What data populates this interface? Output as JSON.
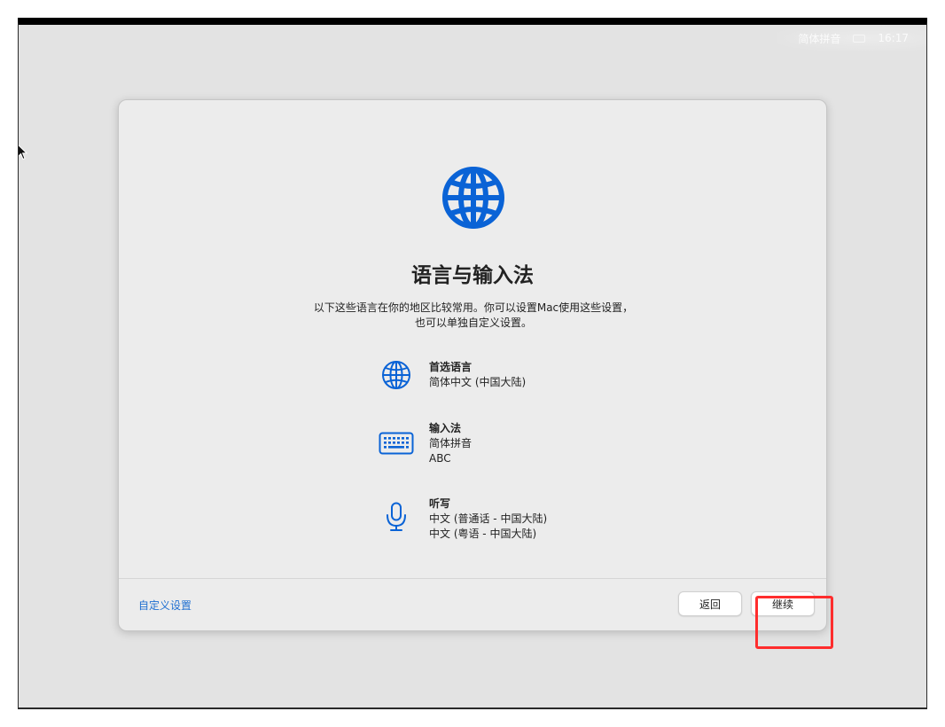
{
  "menubar": {
    "input_method": "简体拼音",
    "keyboard_icon": "keyboard-icon",
    "time": "16:17"
  },
  "dialog": {
    "icon": "globe-icon",
    "title": "语言与输入法",
    "description": [
      "以下这些语言在你的地区比较常用。你可以设置Mac使用这些设置，",
      "也可以单独自定义设置。"
    ],
    "settings": [
      {
        "icon": "globe-icon",
        "label": "首选语言",
        "values": [
          "简体中文 (中国大陆)"
        ]
      },
      {
        "icon": "keyboard-icon",
        "label": "输入法",
        "values": [
          "简体拼音",
          "ABC"
        ]
      },
      {
        "icon": "microphone-icon",
        "label": "听写",
        "values": [
          "中文 (普通话 - 中国大陆)",
          "中文 (粤语 - 中国大陆)"
        ]
      }
    ],
    "footer": {
      "customize_link": "自定义设置",
      "back_button": "返回",
      "continue_button": "继续"
    }
  },
  "colors": {
    "accent": "#1f6fd1",
    "icon_blue": "#0a63d6",
    "highlight": "#ff2d2d",
    "background": "#e3e3e3"
  }
}
